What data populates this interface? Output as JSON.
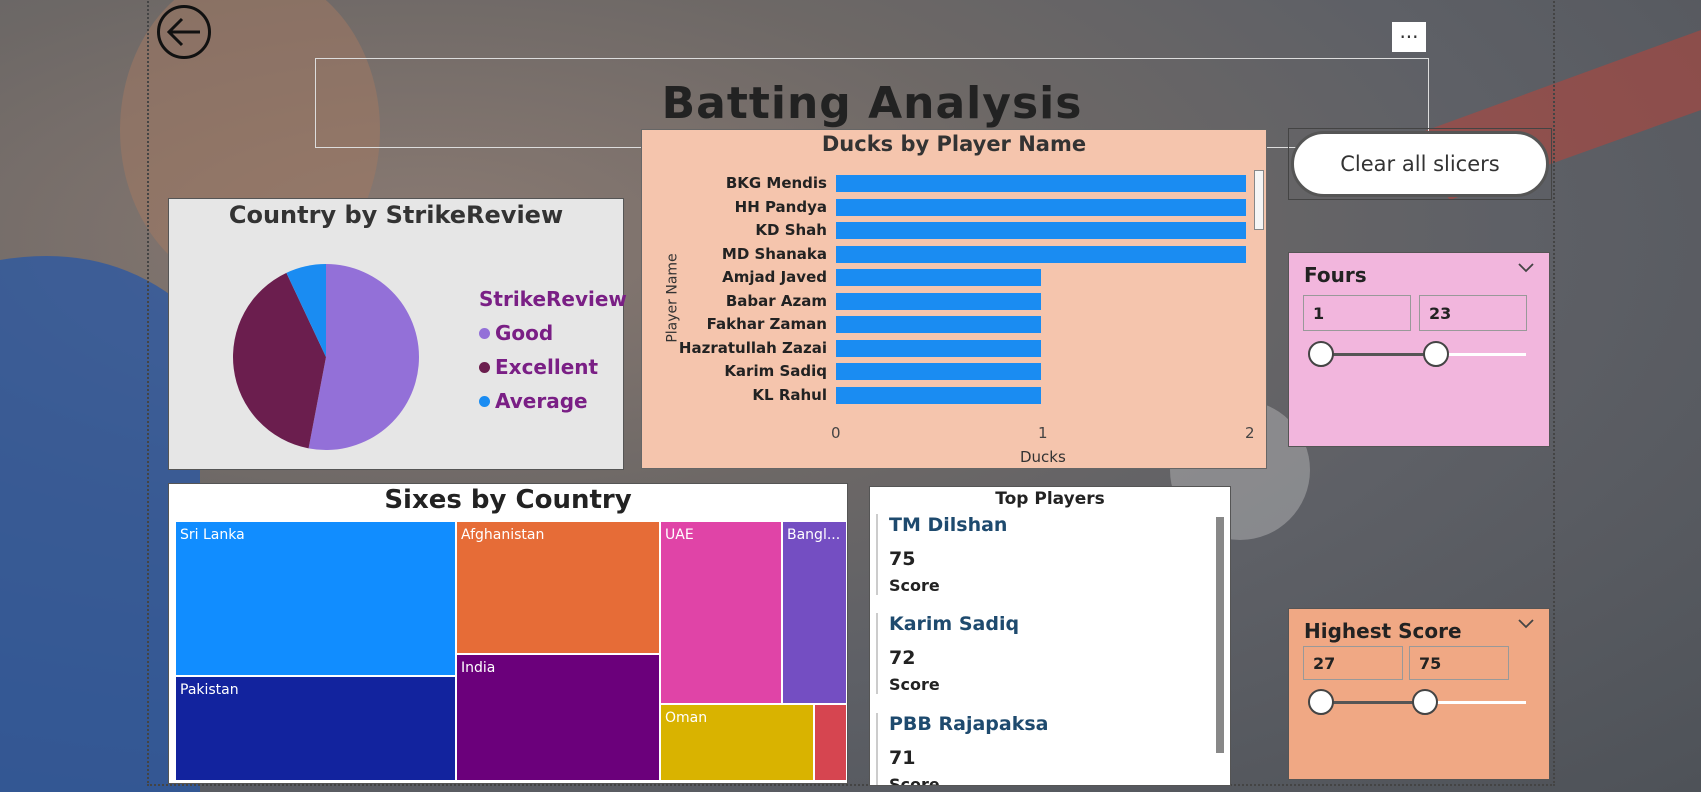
{
  "page_title": "Batting Analysis",
  "more_label": "···",
  "clear_label": "Clear all slicers",
  "pie": {
    "title": "Country by StrikeReview",
    "legend_title": "StrikeReview",
    "legend": [
      {
        "label": "Good",
        "color": "#9370d8"
      },
      {
        "label": "Excellent",
        "color": "#6b1e4e"
      },
      {
        "label": "Average",
        "color": "#1a8cf2"
      }
    ]
  },
  "ducks": {
    "title": "Ducks by Player Name",
    "ylabel": "Player Name",
    "xlabel": "Ducks",
    "ticks": [
      "0",
      "1",
      "2"
    ]
  },
  "fours": {
    "title": "Fours",
    "min": "1",
    "max": "23"
  },
  "highest": {
    "title": "Highest Score",
    "min": "27",
    "max": "75"
  },
  "treemap": {
    "title": "Sixes by Country",
    "tiles": [
      {
        "label": "Sri Lanka",
        "color": "#118dff"
      },
      {
        "label": "Pakistan",
        "color": "#12239e"
      },
      {
        "label": "Afghanistan",
        "color": "#e66c37"
      },
      {
        "label": "India",
        "color": "#6b007b"
      },
      {
        "label": "UAE",
        "color": "#e044a7"
      },
      {
        "label": "Bangl...",
        "color": "#744ec2"
      },
      {
        "label": "Oman",
        "color": "#d9b300"
      },
      {
        "label": "",
        "color": "#d64550"
      }
    ]
  },
  "top_players": {
    "title": "Top Players",
    "cards": [
      {
        "name": "TM Dilshan",
        "value": "75",
        "label": "Score"
      },
      {
        "name": "Karim Sadiq",
        "value": "72",
        "label": "Score"
      },
      {
        "name": "PBB Rajapaksa",
        "value": "71",
        "label": "Score"
      }
    ]
  },
  "chart_data": [
    {
      "type": "pie",
      "title": "Country by StrikeReview",
      "legend_title": "StrikeReview",
      "categories": [
        "Good",
        "Excellent",
        "Average"
      ],
      "values": [
        53,
        40,
        7
      ]
    },
    {
      "type": "bar",
      "orientation": "horizontal",
      "title": "Ducks by Player Name",
      "xlabel": "Ducks",
      "ylabel": "Player Name",
      "categories": [
        "BKG Mendis",
        "HH Pandya",
        "KD Shah",
        "MD Shanaka",
        "Amjad Javed",
        "Babar Azam",
        "Fakhar Zaman",
        "Hazratullah Zazai",
        "Karim Sadiq",
        "KL Rahul"
      ],
      "values": [
        2,
        2,
        2,
        2,
        1,
        1,
        1,
        1,
        1,
        1
      ],
      "xlim": [
        0,
        2
      ]
    }
  ]
}
